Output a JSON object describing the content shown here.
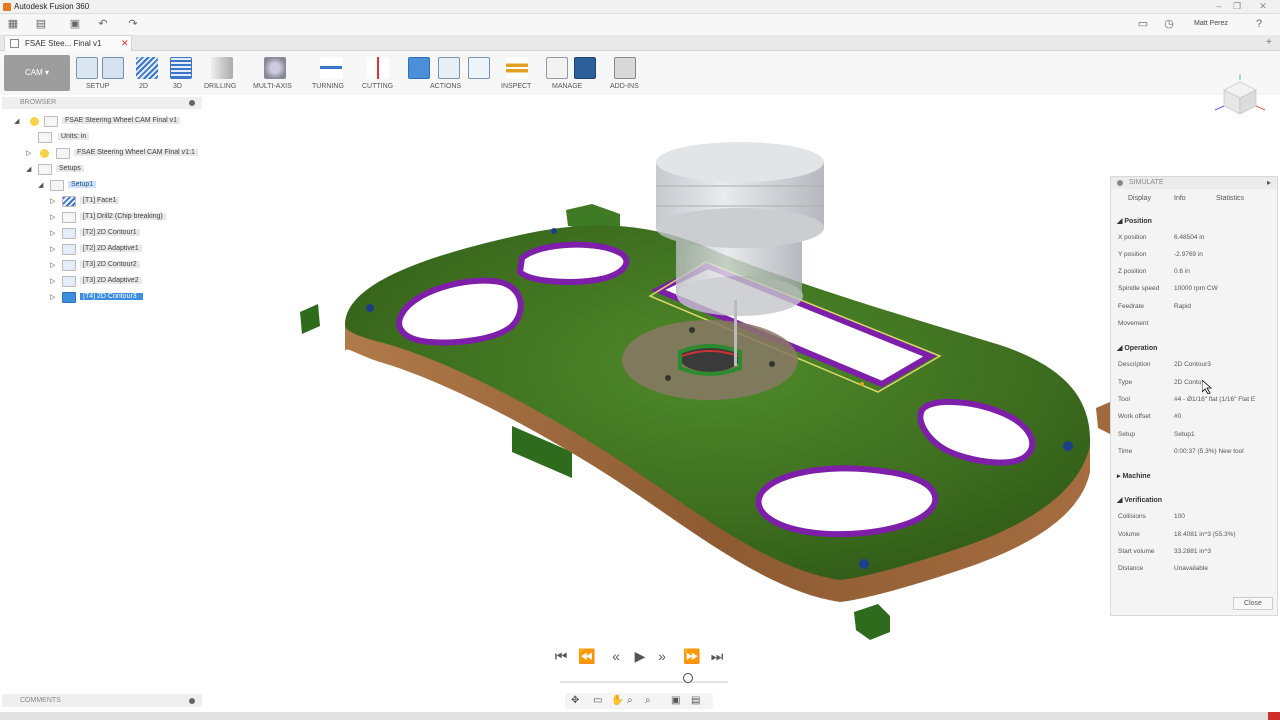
{
  "app": {
    "title": "Autodesk Fusion 360",
    "user": "Matt Perez"
  },
  "document_tab": {
    "label": "FSAE Stee... Final v1"
  },
  "toolbar": {
    "workspace": "CAM",
    "groups": [
      {
        "label": "SETUP",
        "icon": "setup-icon"
      },
      {
        "label": "2D",
        "icon": "2d-icon"
      },
      {
        "label": "3D",
        "icon": "3d-icon"
      },
      {
        "label": "DRILLING",
        "icon": "drill-icon"
      },
      {
        "label": "MULTI-AXIS",
        "icon": "multi-axis-icon"
      },
      {
        "label": "TURNING",
        "icon": "turning-icon"
      },
      {
        "label": "CUTTING",
        "icon": "cutting-icon"
      },
      {
        "label": "ACTIONS",
        "icon": "simulate-icon"
      },
      {
        "label": "INSPECT",
        "icon": "inspect-icon"
      },
      {
        "label": "MANAGE",
        "icon": "manage-icon"
      },
      {
        "label": "ADD-INS",
        "icon": "add-ins-icon"
      }
    ]
  },
  "browser": {
    "title": "BROWSER",
    "items": [
      {
        "label": "FSAE Steering Wheel CAM Final v1"
      },
      {
        "label": "Units: in"
      },
      {
        "label": "FSAE Steering Wheel CAM Final v1:1"
      },
      {
        "label": "Setups"
      },
      {
        "label": "Setup1"
      },
      {
        "label": "[T1] Face1"
      },
      {
        "label": "[T1] Drill2 (Chip breaking)"
      },
      {
        "label": "[T2] 2D Contour1"
      },
      {
        "label": "[T2] 2D Adaptive1"
      },
      {
        "label": "[T3] 2D Contour2"
      },
      {
        "label": "[T3] 2D Adaptive2"
      },
      {
        "label": "[T4] 2D Contour3"
      }
    ]
  },
  "comments": {
    "title": "COMMENTS"
  },
  "simulate": {
    "title": "SIMULATE",
    "tabs": [
      "Display",
      "Info",
      "Statistics"
    ],
    "position": {
      "title": "Position",
      "rows": [
        {
          "label": "X position",
          "value": "6.48504 in"
        },
        {
          "label": "Y position",
          "value": "-2.9769 in"
        },
        {
          "label": "Z position",
          "value": "0.6 in"
        },
        {
          "label": "Spindle speed",
          "value": "10000 rpm CW"
        },
        {
          "label": "Feedrate",
          "value": "Rapid"
        },
        {
          "label": "Movement",
          "value": ""
        }
      ]
    },
    "operation": {
      "title": "Operation",
      "rows": [
        {
          "label": "Description",
          "value": "2D Contour3"
        },
        {
          "label": "Type",
          "value": "2D Conto"
        },
        {
          "label": "Tool",
          "value": "#4 - Ø1/16\" flat (1/16\" Flat E"
        },
        {
          "label": "Work offset",
          "value": "#0"
        },
        {
          "label": "Setup",
          "value": "Setup1"
        },
        {
          "label": "Time",
          "value": "0:00:37 (5.3%) New tool"
        }
      ]
    },
    "machine": {
      "title": "Machine"
    },
    "verification": {
      "title": "Verification",
      "rows": [
        {
          "label": "Collisions",
          "value": "100"
        },
        {
          "label": "Volume",
          "value": "18.4081 in^3 (55.3%)"
        },
        {
          "label": "Start volume",
          "value": "33.2881 in^3"
        },
        {
          "label": "Distance",
          "value": "Unavailable"
        }
      ]
    },
    "close_label": "Close"
  },
  "colors": {
    "part": "#3f6e22",
    "pockets": "#7d1fa8",
    "edge": "#a06a3e",
    "accent": "#3d8de0"
  }
}
